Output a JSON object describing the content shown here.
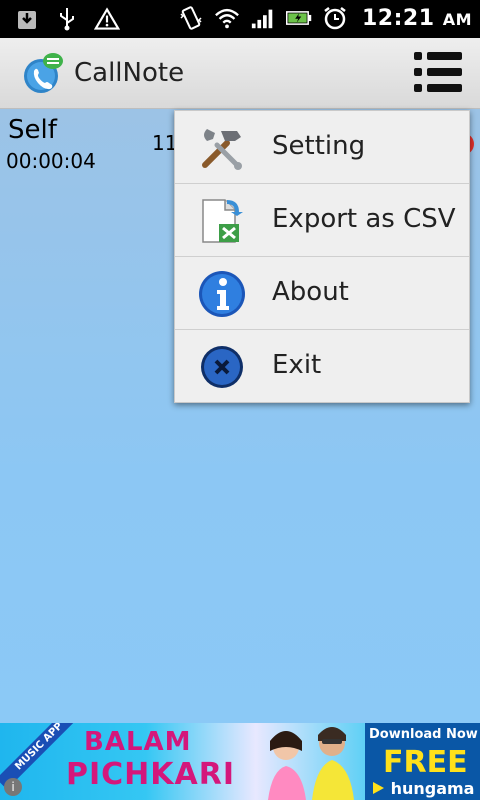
{
  "status_bar": {
    "time": "12:21",
    "ampm": "AM",
    "icons": [
      "download-icon",
      "usb-icon",
      "warning-icon",
      "vibrate-icon",
      "wifi-icon",
      "signal-icon",
      "battery-charging-icon",
      "alarm-icon"
    ]
  },
  "app": {
    "title": "CallNote"
  },
  "call_list": [
    {
      "name": "Self",
      "duration": "00:00:04",
      "number": "11"
    }
  ],
  "menu": {
    "items": [
      {
        "label": "Setting",
        "icon": "tools-icon"
      },
      {
        "label": "Export as CSV",
        "icon": "csv-export-icon"
      },
      {
        "label": "About",
        "icon": "info-icon"
      },
      {
        "label": "Exit",
        "icon": "exit-icon"
      }
    ]
  },
  "ad": {
    "tag": "MUSIC APP",
    "title_line1": "BALAM",
    "title_line2": "PICHKARI",
    "download_text": "Download Now",
    "free_text": "FREE",
    "brand": "hungama"
  },
  "colors": {
    "content_bg": "#8cc7f4",
    "menu_bg": "#efefef",
    "title_bar": "#e4e4e4"
  }
}
